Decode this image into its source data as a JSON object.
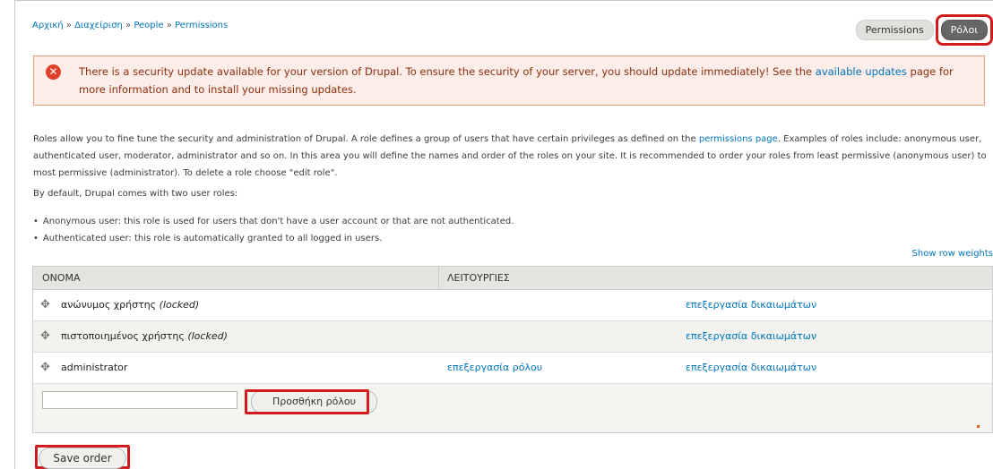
{
  "breadcrumb": {
    "home": "Αρχική",
    "admin": "Διαχείριση",
    "people": "People",
    "permissions": "Permissions",
    "sep": " » "
  },
  "tabs": {
    "permissions": "Permissions",
    "roles": "Ρόλοι"
  },
  "error": {
    "text_before": "There is a security update available for your version of Drupal. To ensure the security of your server, you should update immediately! See the ",
    "link": "available updates",
    "text_after": " page for more information and to install your missing updates."
  },
  "intro": {
    "text_before": "Roles allow you to fine tune the security and administration of Drupal. A role defines a group of users that have certain privileges as defined on the ",
    "link": "permissions page",
    "text_after": ". Examples of roles include: anonymous user, authenticated user, moderator, administrator and so on. In this area you will define the names and order of the roles on your site. It is recommended to order your roles from least permissive (anonymous user) to most permissive (administrator). To delete a role choose \"edit role\"."
  },
  "default_text": "By default, Drupal comes with two user roles:",
  "bullets": [
    "Anonymous user: this role is used for users that don't have a user account or that are not authenticated.",
    "Authenticated user: this role is automatically granted to all logged in users."
  ],
  "show_row_weights": "Show row weights",
  "table": {
    "col_name": "ΟΝΟΜΑ",
    "col_ops": "ΛΕΙΤΟΥΡΓΙΕΣ",
    "rows": [
      {
        "name": "ανώνυμος χρήστης",
        "locked": "(locked)",
        "edit_role": "",
        "edit_perms": "επεξεργασία δικαιωμάτων"
      },
      {
        "name": "πιστοποιημένος χρήστης",
        "locked": "(locked)",
        "edit_role": "",
        "edit_perms": "επεξεργασία δικαιωμάτων"
      },
      {
        "name": "administrator",
        "locked": "",
        "edit_role": "επεξεργασία ρόλου",
        "edit_perms": "επεξεργασία δικαιωμάτων"
      }
    ],
    "new_role_value": "",
    "add_role_label": "Προσθήκη ρόλου"
  },
  "save_order": "Save order",
  "icons": {
    "error": "error-x-icon",
    "drag": "drag-handle-icon"
  },
  "colors": {
    "link": "#0074bd",
    "error_bg": "#fcede9",
    "error_border": "#ed9c84",
    "highlight": "#d01c1c",
    "active_tab": "#666666"
  }
}
